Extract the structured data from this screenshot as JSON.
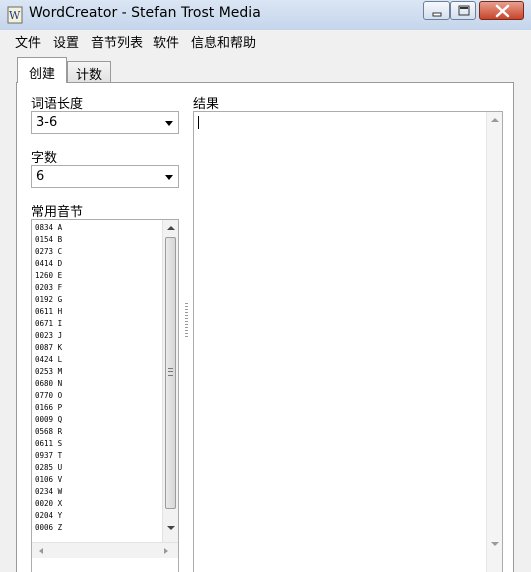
{
  "window": {
    "title": "WordCreator - Stefan Trost Media"
  },
  "menu": [
    "文件",
    "设置",
    "音节列表",
    "软件",
    "信息和帮助"
  ],
  "tabs": {
    "create": "创建",
    "count": "计数"
  },
  "left": {
    "word_length_label": "词语长度",
    "word_length_value": "3-6",
    "word_count_label": "字数",
    "word_count_value": "6",
    "syllables_label": "常用音节",
    "syllables": [
      "0834 A",
      "0154 B",
      "0273 C",
      "0414 D",
      "1260 E",
      "0203 F",
      "0192 G",
      "0611 H",
      "0671 I",
      "0023 J",
      "0087 K",
      "0424 L",
      "0253 M",
      "0680 N",
      "0770 O",
      "0166 P",
      "0009 Q",
      "0568 R",
      "0611 S",
      "0937 T",
      "0285 U",
      "0106 V",
      "0234 W",
      "0020 X",
      "0204 Y",
      "0006 Z"
    ]
  },
  "right": {
    "result_label": "结果",
    "result_text": ""
  },
  "icons": {
    "app": "app-icon",
    "minimize": "minimize-icon",
    "maximize": "maximize-icon",
    "close": "close-icon",
    "dropdown": "chevron-down-icon"
  }
}
